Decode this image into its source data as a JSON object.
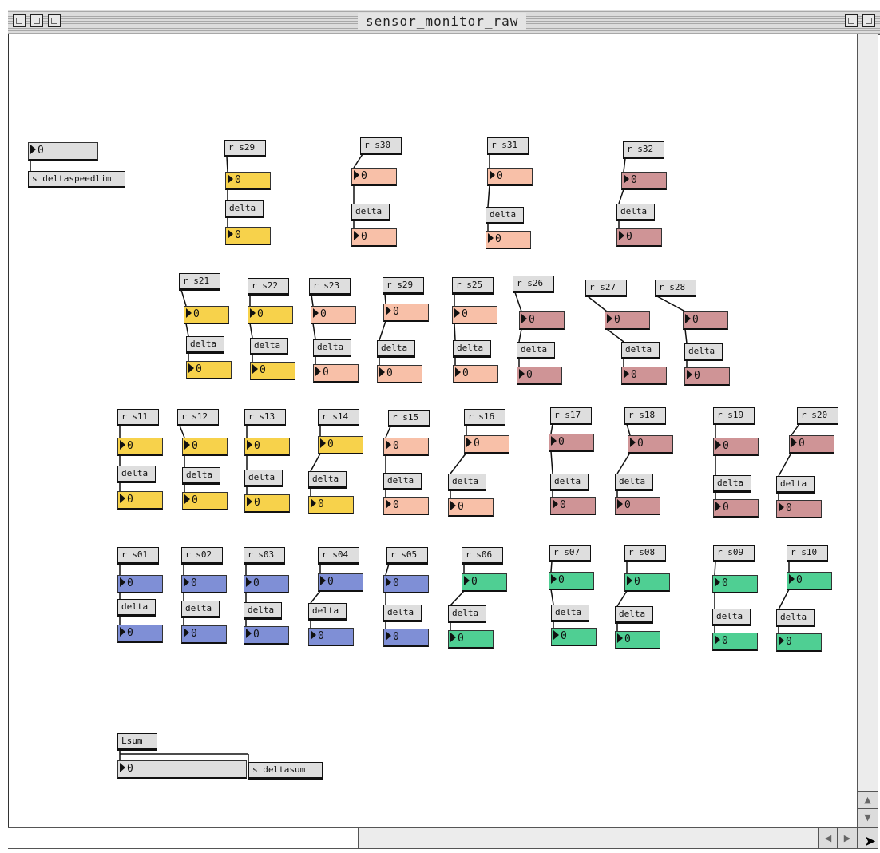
{
  "window": {
    "title": "sensor_monitor_raw"
  },
  "colors": {
    "yellow": "#f7d24b",
    "peach": "#f8c0a8",
    "rose": "#cf9496",
    "blue": "#7f8fd6",
    "green": "#4fcf93",
    "gray": "#dedede"
  },
  "patch": {
    "top_number_value": "0",
    "send_speedlim": "s deltaspeedlim",
    "sum_object": "Lsum",
    "sum_number_value": "0",
    "send_deltasum": "s deltasum",
    "delta_label": "delta",
    "number_value": "0",
    "receivers": [
      "r s29",
      "r s30",
      "r s31",
      "r s32",
      "r s21",
      "r s22",
      "r s23",
      "r s29",
      "r s25",
      "r s26",
      "r s27",
      "r s28",
      "r s11",
      "r s12",
      "r s13",
      "r s14",
      "r s15",
      "r s16",
      "r s17",
      "r s18",
      "r s19",
      "r s20",
      "r s01",
      "r s02",
      "r s03",
      "r s04",
      "r s05",
      "r s06",
      "r s07",
      "r s08",
      "r s09",
      "r s10"
    ]
  }
}
